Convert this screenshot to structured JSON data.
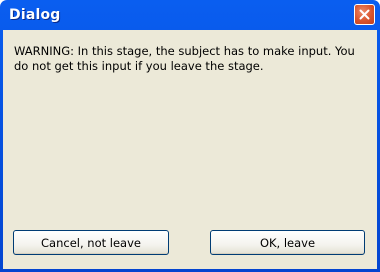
{
  "window": {
    "title": "Dialog"
  },
  "titlebar": {
    "close_icon": "close-icon",
    "close_color": "#d9542d"
  },
  "message": {
    "text": "WARNING: In this stage, the subject has to make input. You do not get this input if you leave the stage."
  },
  "buttons": {
    "cancel_label": "Cancel, not leave",
    "ok_label": "OK, leave"
  },
  "colors": {
    "titlebar": "#0653e3",
    "client_background": "#ece9d8",
    "button_border": "#003c74"
  }
}
